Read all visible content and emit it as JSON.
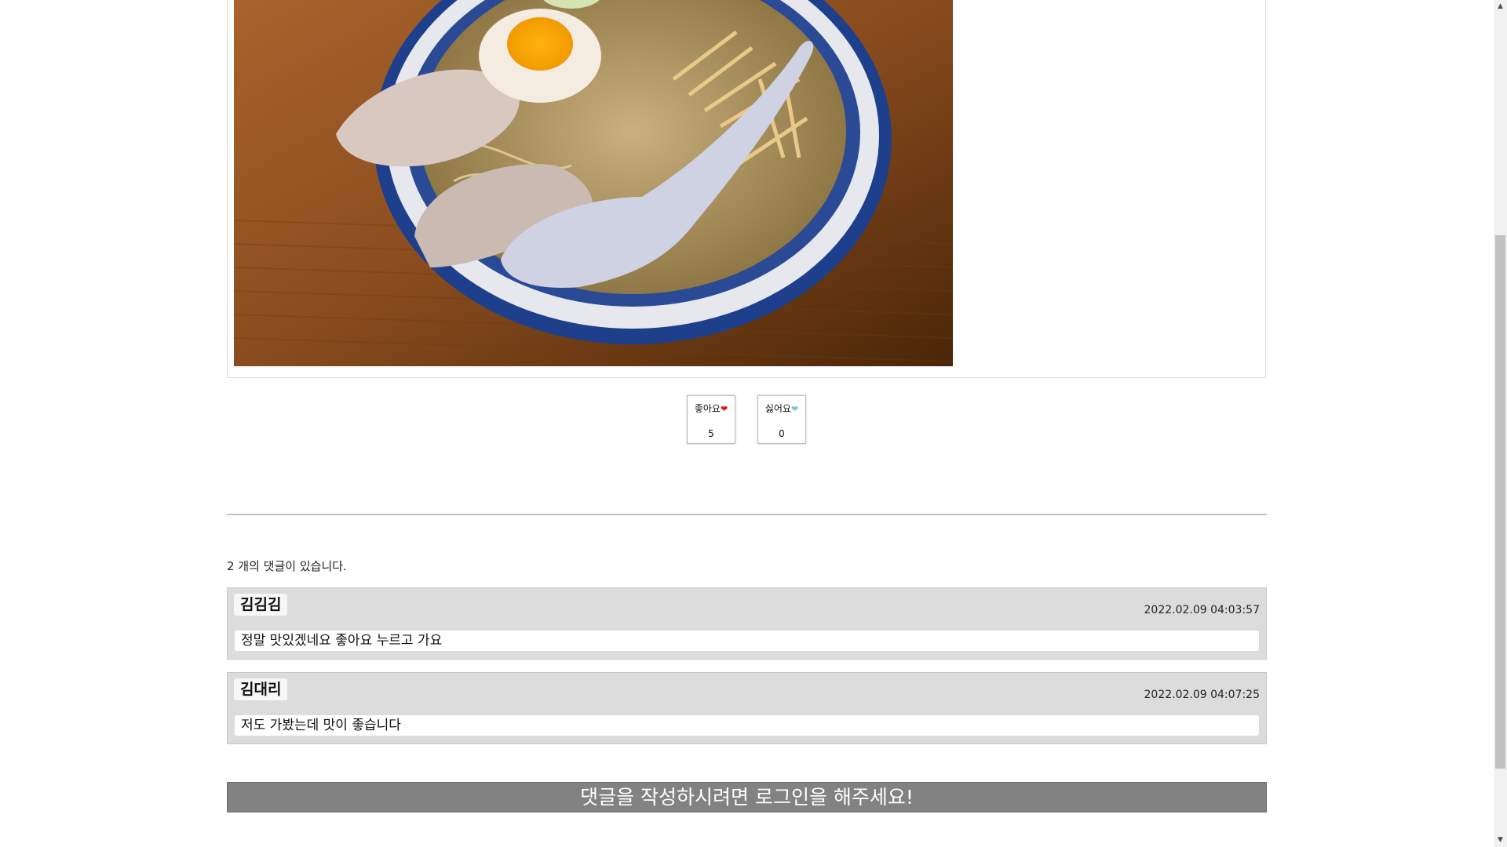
{
  "post": {
    "image_name": "ramen-bowl-photo"
  },
  "reactions": {
    "like_label": "좋아요",
    "like_count": "5",
    "dislike_label": "싫어요",
    "dislike_count": "0",
    "like_icon": "red-heart-icon",
    "dislike_icon": "light-blue-heart-icon"
  },
  "comments": {
    "count_text": "2 개의 댓글이 있습니다.",
    "items": [
      {
        "author": "김김김",
        "date": "2022.02.09 04:03:57",
        "body": "정말 맛있겠네요 좋아요 누르고 가요"
      },
      {
        "author": "김대리",
        "date": "2022.02.09 04:07:25",
        "body": "저도 가봤는데 맛이 좋습니다"
      }
    ]
  },
  "login_banner": {
    "text": "댓글을 작성하시려면 로그인을 해주세요!"
  },
  "colors": {
    "comment_bg": "#dcdcdc",
    "banner_bg": "#828282",
    "like_heart": "#e01515",
    "dislike_heart": "#7cc4e6"
  }
}
